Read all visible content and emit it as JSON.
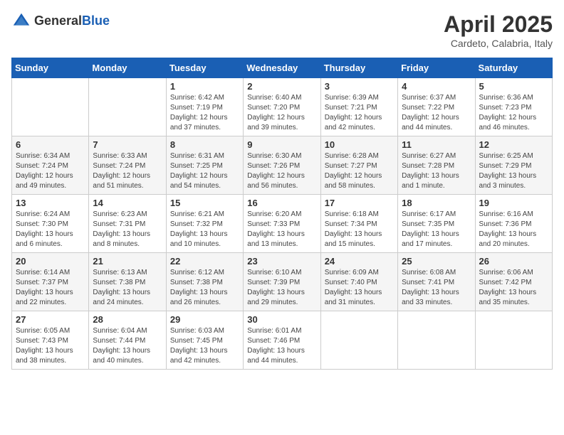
{
  "header": {
    "logo_general": "General",
    "logo_blue": "Blue",
    "month_title": "April 2025",
    "location": "Cardeto, Calabria, Italy"
  },
  "weekdays": [
    "Sunday",
    "Monday",
    "Tuesday",
    "Wednesday",
    "Thursday",
    "Friday",
    "Saturday"
  ],
  "weeks": [
    [
      null,
      null,
      {
        "day": 1,
        "sunrise": "6:42 AM",
        "sunset": "7:19 PM",
        "daylight": "12 hours and 37 minutes."
      },
      {
        "day": 2,
        "sunrise": "6:40 AM",
        "sunset": "7:20 PM",
        "daylight": "12 hours and 39 minutes."
      },
      {
        "day": 3,
        "sunrise": "6:39 AM",
        "sunset": "7:21 PM",
        "daylight": "12 hours and 42 minutes."
      },
      {
        "day": 4,
        "sunrise": "6:37 AM",
        "sunset": "7:22 PM",
        "daylight": "12 hours and 44 minutes."
      },
      {
        "day": 5,
        "sunrise": "6:36 AM",
        "sunset": "7:23 PM",
        "daylight": "12 hours and 46 minutes."
      }
    ],
    [
      {
        "day": 6,
        "sunrise": "6:34 AM",
        "sunset": "7:24 PM",
        "daylight": "12 hours and 49 minutes."
      },
      {
        "day": 7,
        "sunrise": "6:33 AM",
        "sunset": "7:24 PM",
        "daylight": "12 hours and 51 minutes."
      },
      {
        "day": 8,
        "sunrise": "6:31 AM",
        "sunset": "7:25 PM",
        "daylight": "12 hours and 54 minutes."
      },
      {
        "day": 9,
        "sunrise": "6:30 AM",
        "sunset": "7:26 PM",
        "daylight": "12 hours and 56 minutes."
      },
      {
        "day": 10,
        "sunrise": "6:28 AM",
        "sunset": "7:27 PM",
        "daylight": "12 hours and 58 minutes."
      },
      {
        "day": 11,
        "sunrise": "6:27 AM",
        "sunset": "7:28 PM",
        "daylight": "13 hours and 1 minute."
      },
      {
        "day": 12,
        "sunrise": "6:25 AM",
        "sunset": "7:29 PM",
        "daylight": "13 hours and 3 minutes."
      }
    ],
    [
      {
        "day": 13,
        "sunrise": "6:24 AM",
        "sunset": "7:30 PM",
        "daylight": "13 hours and 6 minutes."
      },
      {
        "day": 14,
        "sunrise": "6:23 AM",
        "sunset": "7:31 PM",
        "daylight": "13 hours and 8 minutes."
      },
      {
        "day": 15,
        "sunrise": "6:21 AM",
        "sunset": "7:32 PM",
        "daylight": "13 hours and 10 minutes."
      },
      {
        "day": 16,
        "sunrise": "6:20 AM",
        "sunset": "7:33 PM",
        "daylight": "13 hours and 13 minutes."
      },
      {
        "day": 17,
        "sunrise": "6:18 AM",
        "sunset": "7:34 PM",
        "daylight": "13 hours and 15 minutes."
      },
      {
        "day": 18,
        "sunrise": "6:17 AM",
        "sunset": "7:35 PM",
        "daylight": "13 hours and 17 minutes."
      },
      {
        "day": 19,
        "sunrise": "6:16 AM",
        "sunset": "7:36 PM",
        "daylight": "13 hours and 20 minutes."
      }
    ],
    [
      {
        "day": 20,
        "sunrise": "6:14 AM",
        "sunset": "7:37 PM",
        "daylight": "13 hours and 22 minutes."
      },
      {
        "day": 21,
        "sunrise": "6:13 AM",
        "sunset": "7:38 PM",
        "daylight": "13 hours and 24 minutes."
      },
      {
        "day": 22,
        "sunrise": "6:12 AM",
        "sunset": "7:38 PM",
        "daylight": "13 hours and 26 minutes."
      },
      {
        "day": 23,
        "sunrise": "6:10 AM",
        "sunset": "7:39 PM",
        "daylight": "13 hours and 29 minutes."
      },
      {
        "day": 24,
        "sunrise": "6:09 AM",
        "sunset": "7:40 PM",
        "daylight": "13 hours and 31 minutes."
      },
      {
        "day": 25,
        "sunrise": "6:08 AM",
        "sunset": "7:41 PM",
        "daylight": "13 hours and 33 minutes."
      },
      {
        "day": 26,
        "sunrise": "6:06 AM",
        "sunset": "7:42 PM",
        "daylight": "13 hours and 35 minutes."
      }
    ],
    [
      {
        "day": 27,
        "sunrise": "6:05 AM",
        "sunset": "7:43 PM",
        "daylight": "13 hours and 38 minutes."
      },
      {
        "day": 28,
        "sunrise": "6:04 AM",
        "sunset": "7:44 PM",
        "daylight": "13 hours and 40 minutes."
      },
      {
        "day": 29,
        "sunrise": "6:03 AM",
        "sunset": "7:45 PM",
        "daylight": "13 hours and 42 minutes."
      },
      {
        "day": 30,
        "sunrise": "6:01 AM",
        "sunset": "7:46 PM",
        "daylight": "13 hours and 44 minutes."
      },
      null,
      null,
      null
    ]
  ],
  "labels": {
    "sunrise_prefix": "Sunrise: ",
    "sunset_prefix": "Sunset: ",
    "daylight_prefix": "Daylight: "
  }
}
